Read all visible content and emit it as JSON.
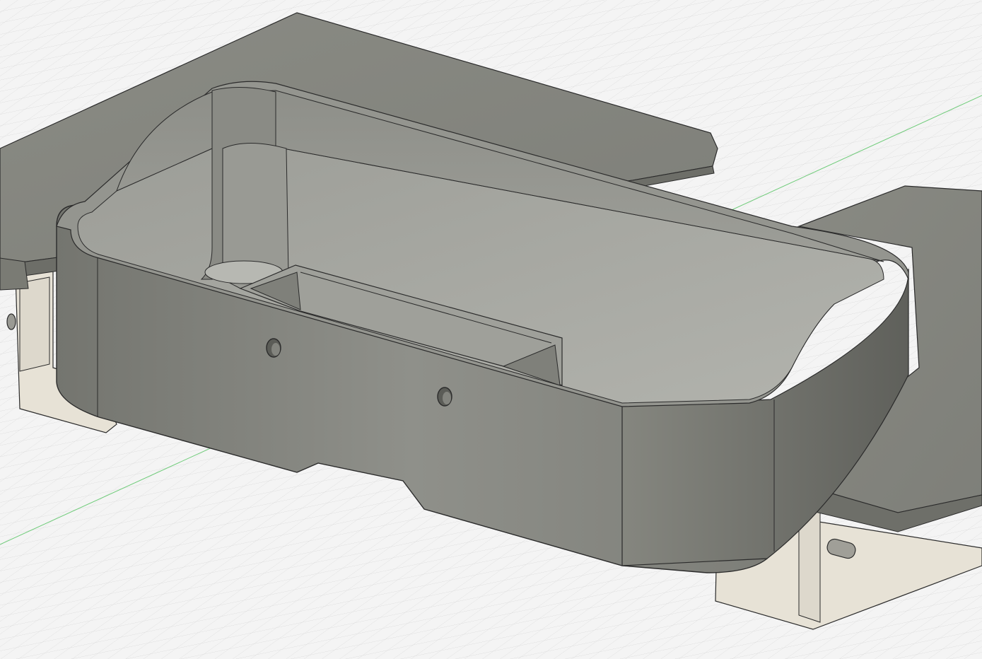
{
  "viewport": {
    "kind": "3d-cad-model-view",
    "background_color": "#f4f4f4",
    "grid_color": "#d9d9d9",
    "grid_minor_color": "#e6e6e6",
    "x_axis_color": "#cc2a2a",
    "y_axis_color": "#3fb34f",
    "model_body_color": "#8c8d86",
    "model_body_dark_color": "#6d6e68",
    "model_inner_color": "#a3a49e",
    "bracket_color": "#e7e2d6",
    "edge_color": "#2b2b2b"
  }
}
